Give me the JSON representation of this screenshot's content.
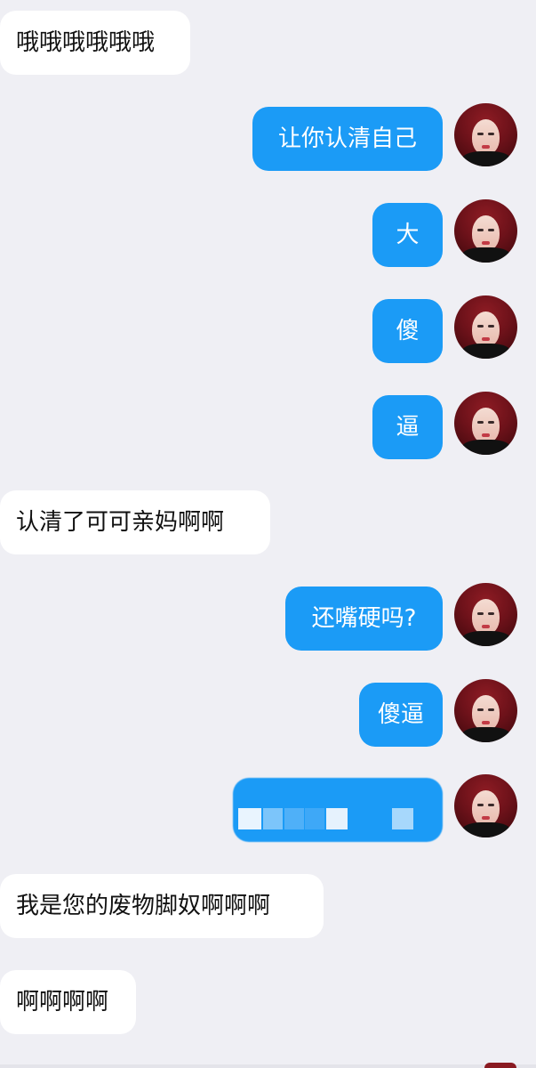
{
  "messages": [
    {
      "side": "in",
      "text": "哦哦哦哦哦哦"
    },
    {
      "side": "out",
      "text": "让你认清自己"
    },
    {
      "side": "out",
      "text": "大"
    },
    {
      "side": "out",
      "text": "傻"
    },
    {
      "side": "out",
      "text": "逼"
    },
    {
      "side": "in",
      "text": "认清了可可亲妈啊啊"
    },
    {
      "side": "out",
      "text": "还嘴硬吗?"
    },
    {
      "side": "out",
      "text": "傻逼"
    },
    {
      "side": "out",
      "text": ""
    },
    {
      "side": "in",
      "text": "我是您的废物脚奴啊啊啊"
    },
    {
      "side": "in",
      "text": "啊啊啊啊"
    }
  ],
  "colors": {
    "background": "#efeff4",
    "incoming_bubble": "#ffffff",
    "outgoing_bubble": "#1b9bf6"
  },
  "icons": {
    "avatar": "profile-avatar-icon"
  }
}
